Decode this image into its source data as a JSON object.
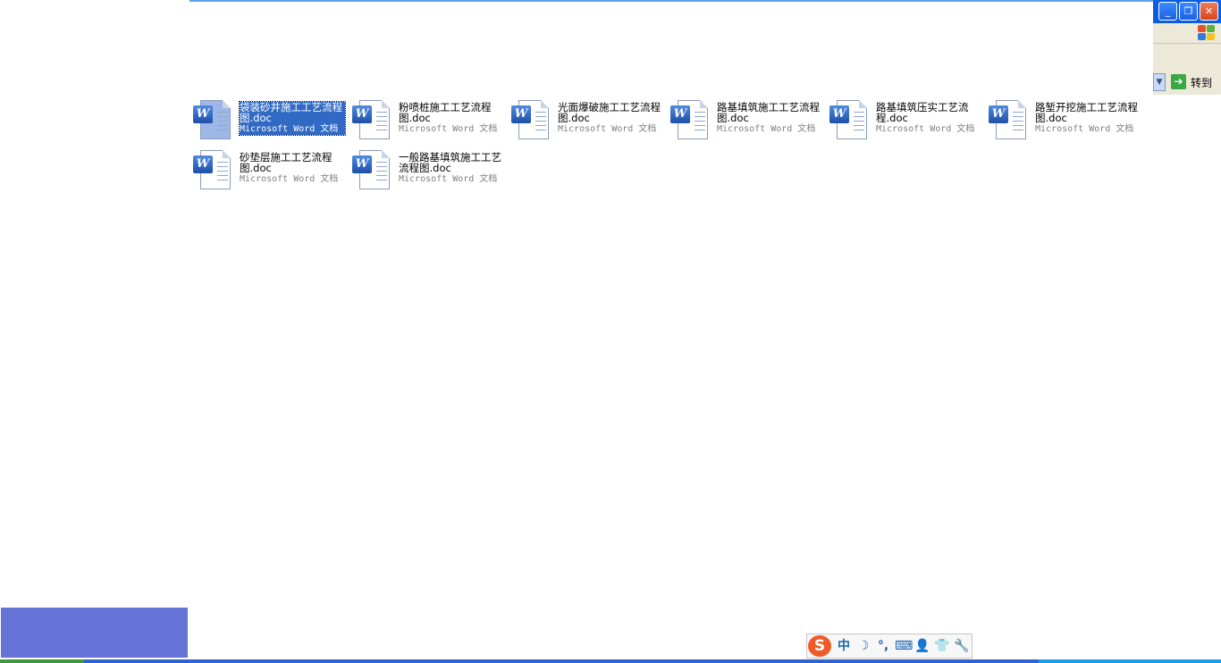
{
  "files": [
    {
      "name": "袋装砂井施工工艺流程图.doc",
      "type": "Microsoft Word 文档",
      "selected": true
    },
    {
      "name": "粉喷桩施工工艺流程图.doc",
      "type": "Microsoft Word 文档",
      "selected": false
    },
    {
      "name": "光面爆破施工工艺流程图.doc",
      "type": "Microsoft Word 文档",
      "selected": false
    },
    {
      "name": "路基填筑施工工艺流程图.doc",
      "type": "Microsoft Word 文档",
      "selected": false
    },
    {
      "name": "路基填筑压实工艺流程.doc",
      "type": "Microsoft Word 文档",
      "selected": false
    },
    {
      "name": "路堑开挖施工工艺流程图.doc",
      "type": "Microsoft Word 文档",
      "selected": false
    },
    {
      "name": "砂垫层施工工艺流程图.doc",
      "type": "Microsoft Word 文档",
      "selected": false
    },
    {
      "name": "一般路基填筑施工工艺流程图.doc",
      "type": "Microsoft Word 文档",
      "selected": false
    }
  ],
  "addressbar": {
    "go_label": "转到"
  },
  "window_buttons": {
    "minimize": "_",
    "maximize": "❐",
    "close": "✕"
  },
  "ime_toolbar": {
    "logo": "S",
    "mode": "中",
    "moon": "☽",
    "punct": "°,",
    "keyboard": "⌨",
    "user": "👤",
    "skin": "👕",
    "settings": "🔧"
  },
  "colors": {
    "selection": "#316ac5",
    "title_bar": "#0a5de0",
    "word_blue": "#2b5fb4",
    "sogou_orange": "#f05a28"
  }
}
